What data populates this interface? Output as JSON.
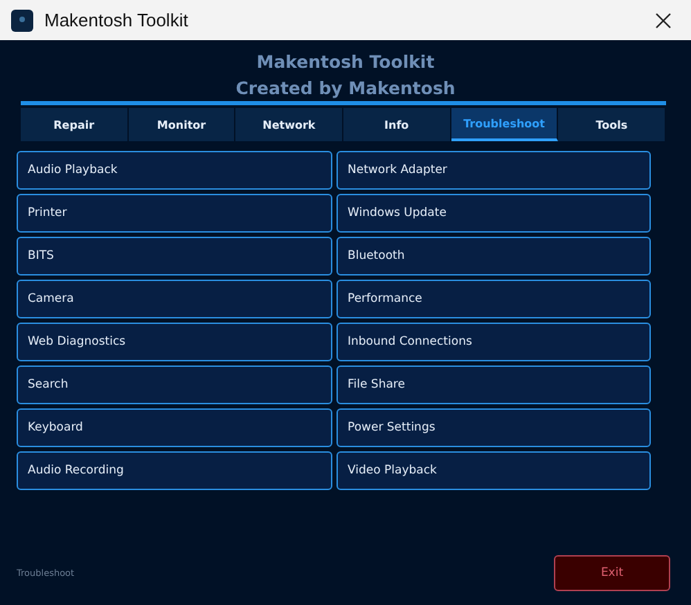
{
  "window": {
    "title": "Makentosh Toolkit"
  },
  "header": {
    "title": "Makentosh Toolkit",
    "subtitle": "Created by Makentosh"
  },
  "tabs": [
    {
      "label": "Repair",
      "selected": false
    },
    {
      "label": "Monitor",
      "selected": false
    },
    {
      "label": "Network",
      "selected": false
    },
    {
      "label": "Info",
      "selected": false
    },
    {
      "label": "Troubleshoot",
      "selected": true
    },
    {
      "label": "Tools",
      "selected": false
    }
  ],
  "buttons": [
    "Audio Playback",
    "Network Adapter",
    "Printer",
    "Windows Update",
    "BITS",
    "Bluetooth",
    "Camera",
    "Performance",
    "Web Diagnostics",
    "Inbound Connections",
    "Search",
    "File Share",
    "Keyboard",
    "Power Settings",
    "Audio Recording",
    "Video Playback"
  ],
  "status_bar": {
    "text": "Troubleshoot",
    "exit_button": "Exit"
  }
}
